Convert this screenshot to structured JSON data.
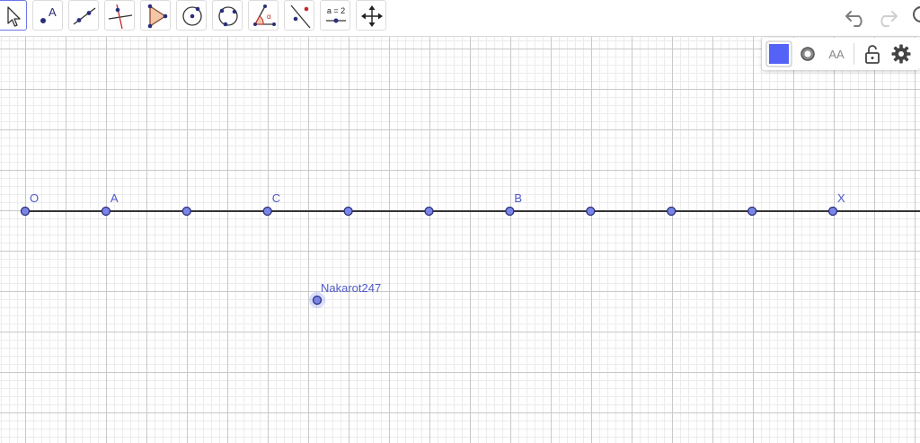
{
  "toolbar": {
    "tools": [
      {
        "name": "move-tool",
        "active": true
      },
      {
        "name": "point-tool",
        "active": false
      },
      {
        "name": "line-tool",
        "active": false
      },
      {
        "name": "perpendicular-line-tool",
        "active": false
      },
      {
        "name": "polygon-tool",
        "active": false
      },
      {
        "name": "circle-center-point-tool",
        "active": false
      },
      {
        "name": "circle-three-points-tool",
        "active": false
      },
      {
        "name": "angle-tool",
        "active": false
      },
      {
        "name": "reflect-about-line-tool",
        "active": false
      },
      {
        "name": "slider-tool",
        "active": false
      },
      {
        "name": "move-graphics-view-tool",
        "active": false
      }
    ],
    "point_tool_letter": "A",
    "slider_tool_text": "a = 2"
  },
  "style_bar": {
    "color_swatch": "#5462f5",
    "point_style_icon": "point-style-icon",
    "text_size_label": "AA",
    "lock_icon": "unlock-icon",
    "settings_icon": "gear-icon"
  },
  "colors": {
    "accent": "#5462f5",
    "point_fill": "#7b85e8",
    "point_stroke": "#2a2f7a",
    "label": "#4f58c8",
    "line": "#333333"
  },
  "axis_points": {
    "labels": [
      "O",
      "A",
      "",
      "C",
      "",
      "",
      "B",
      "",
      "",
      "",
      "X"
    ]
  },
  "free_point": {
    "label": "Nakarot247"
  }
}
